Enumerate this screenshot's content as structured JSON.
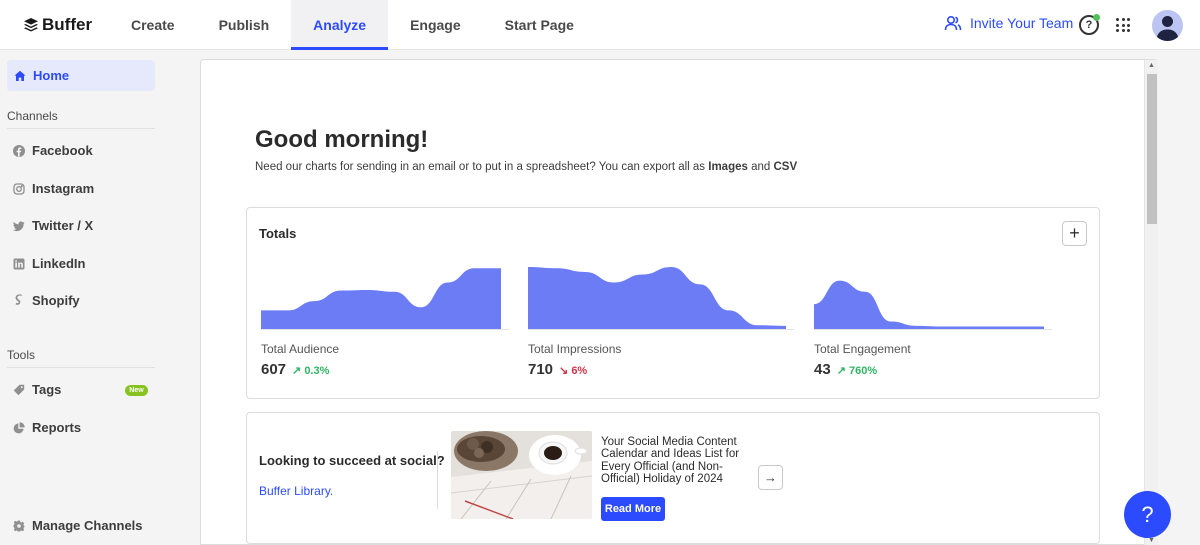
{
  "brand": {
    "name": "Buffer"
  },
  "nav": {
    "items": [
      {
        "label": "Create"
      },
      {
        "label": "Publish"
      },
      {
        "label": "Analyze"
      },
      {
        "label": "Engage"
      },
      {
        "label": "Start Page"
      }
    ],
    "active": "Analyze",
    "invite_label": "Invite Your Team",
    "help_glyph": "?"
  },
  "sidebar": {
    "home": "Home",
    "channels_heading": "Channels",
    "channels": [
      {
        "label": "Facebook",
        "icon": "facebook-icon"
      },
      {
        "label": "Instagram",
        "icon": "instagram-icon"
      },
      {
        "label": "Twitter / X",
        "icon": "twitter-icon"
      },
      {
        "label": "LinkedIn",
        "icon": "linkedin-icon"
      },
      {
        "label": "Shopify",
        "icon": "shopify-icon"
      }
    ],
    "tools_heading": "Tools",
    "tools": [
      {
        "label": "Tags",
        "icon": "tag-icon",
        "badge": "New"
      },
      {
        "label": "Reports",
        "icon": "pie-chart-icon"
      }
    ],
    "manage": "Manage Channels"
  },
  "main": {
    "greeting": "Good morning!",
    "subtitle_prefix": "Need our charts for sending in an email or to put in a spreadsheet? You can export all as ",
    "subtitle_images": "Images",
    "subtitle_and": " and ",
    "subtitle_csv": "CSV"
  },
  "totals": {
    "title": "Totals",
    "add_glyph": "+",
    "metrics": [
      {
        "label": "Total Audience",
        "value": "607",
        "change": "0.3%",
        "direction": "up"
      },
      {
        "label": "Total Impressions",
        "value": "710",
        "change": "6%",
        "direction": "down"
      },
      {
        "label": "Total Engagement",
        "value": "43",
        "change": "760%",
        "direction": "up"
      }
    ]
  },
  "chart_data": [
    {
      "type": "area",
      "name": "Total Audience",
      "values": [
        0.3,
        0.3,
        0.45,
        0.62,
        0.63,
        0.6,
        0.35,
        0.75,
        0.98,
        0.98
      ]
    },
    {
      "type": "area",
      "name": "Total Impressions",
      "values": [
        1.0,
        0.98,
        0.92,
        0.75,
        0.88,
        1.0,
        0.72,
        0.3,
        0.06,
        0.05
      ]
    },
    {
      "type": "area",
      "name": "Total Engagement",
      "values": [
        0.4,
        0.78,
        0.6,
        0.12,
        0.05,
        0.04,
        0.04,
        0.04,
        0.04,
        0.04
      ]
    }
  ],
  "promo": {
    "question": "Looking to succeed at social?",
    "library": "Buffer Library.",
    "article_title": "Your Social Media Content Calendar and Ideas List for Every Official (and Non-Official) Holiday of 2024",
    "read_more": "Read More",
    "arrow_glyph": "→"
  },
  "colors": {
    "accent": "#2c4bff",
    "chart_fill": "#6b7cf5",
    "up": "#2fb563",
    "down": "#d2334b"
  },
  "help_fab": {
    "glyph": "?"
  }
}
